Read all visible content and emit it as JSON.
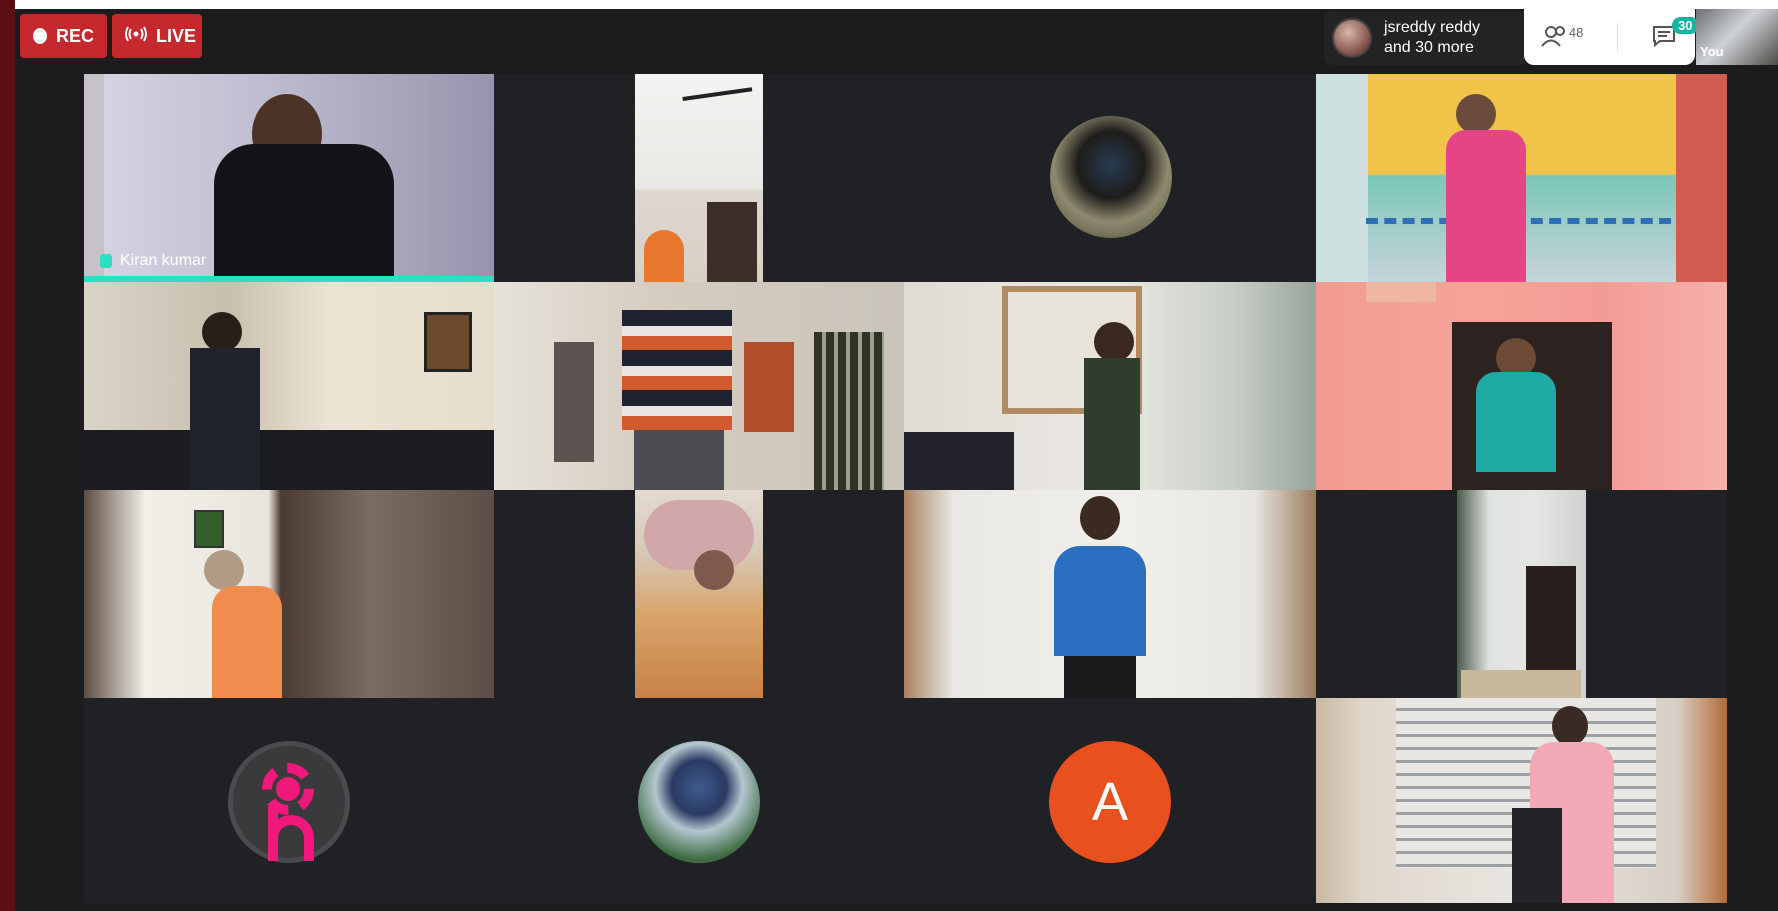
{
  "toolbar": {
    "rec_label": "REC",
    "live_label": "LIVE"
  },
  "participants_chip": {
    "line1": "jsreddy reddy",
    "line2": "and 30 more"
  },
  "counters": {
    "participants_count": "48",
    "chat_count": "30"
  },
  "self_view": {
    "label": "You"
  },
  "active_speaker": {
    "name": "Kiran kumar"
  },
  "avatars": {
    "letter_avatar": "A"
  },
  "colors": {
    "rec_live": "#c5282d",
    "speaker_highlight": "#29e0c3",
    "badge": "#13b6a0",
    "letter_avatar_bg": "#e8501d",
    "logo_pink": "#f0187a"
  }
}
